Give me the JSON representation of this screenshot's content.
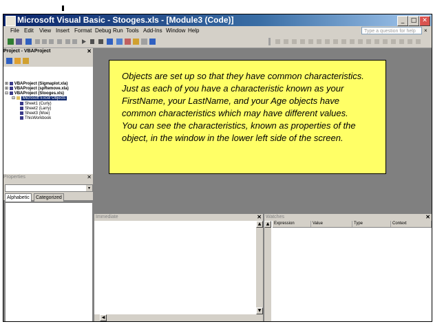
{
  "window": {
    "title": "Microsoft Visual Basic - Stooges.xls - [Module3 (Code)]"
  },
  "menu": {
    "items": [
      "File",
      "Edit",
      "View",
      "Insert",
      "Format",
      "Debug",
      "Run",
      "Tools",
      "Add-Ins",
      "Window",
      "Help"
    ],
    "help_placeholder": "Type a question for help"
  },
  "project": {
    "header": "Project - VBAProject",
    "tree": [
      {
        "label": "VBAProject (Sigmaplot.xla)"
      },
      {
        "label": "VBAProject (spRemove.xla)"
      },
      {
        "label": "VBAProject (Stooges.xls)"
      },
      {
        "label": "Microsoft Excel Objects"
      },
      {
        "label": "Sheet1 (Curly)"
      },
      {
        "label": "Sheet2 (Larry)"
      },
      {
        "label": "Sheet3 (Moe)"
      },
      {
        "label": "ThisWorkbook"
      }
    ]
  },
  "properties": {
    "header": "Properties",
    "tabs": [
      "Alphabetic",
      "Categorized"
    ]
  },
  "immediate": {
    "header": "Immediate"
  },
  "watches": {
    "header": "Watches",
    "columns": [
      "Expression",
      "Value",
      "Type",
      "Context"
    ]
  },
  "callout": {
    "paragraph1": "Objects are set up so that they have common characteristics. Just as each of you have a characteristic known as your FirstName, your LastName, and your Age objects have common characteristics which may have different values.",
    "paragraph2": "You can see the characteristics, known as properties of the object, in the window in the lower left side of the screen."
  },
  "colors": {
    "callout_bg": "#ffff66",
    "titlebar": "#0a246a",
    "workspace": "#808080"
  }
}
